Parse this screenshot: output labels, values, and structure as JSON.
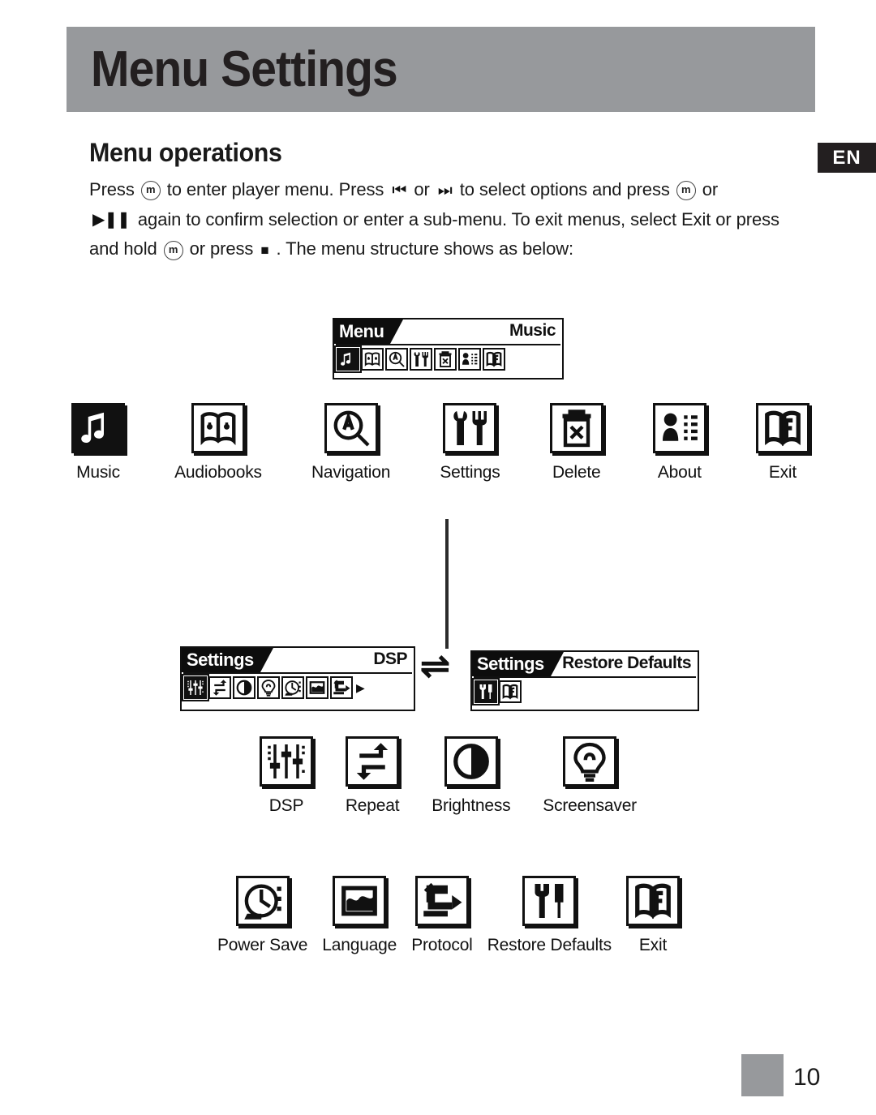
{
  "header": {
    "title": "Menu Settings",
    "band_color": "#97999c"
  },
  "language_badge": {
    "label": "EN",
    "bg": "#231f20"
  },
  "section": {
    "heading": "Menu operations",
    "paragraph_lines": [
      {
        "before": "Press ",
        "icon1": "menu-button-icon",
        "mid1": " to enter player menu. Press ",
        "icon2": "prev-track-icon",
        "mid2": " or ",
        "icon3": "next-track-icon",
        "mid3": " to select options and press ",
        "icon4": "menu-button-icon",
        "after": " or"
      },
      {
        "icon1": "play-pause-icon",
        "text": " again to confirm selection or enter a sub-menu. To exit menus, select Exit or press"
      },
      {
        "before": "and hold ",
        "icon1": "menu-button-icon",
        "mid1": " or press ",
        "icon2": "stop-icon",
        "after": " . The menu structure shows as below:"
      }
    ],
    "glyphs": {
      "menu": "m",
      "prev": "⏮",
      "next": "⏭",
      "play_pause": "▶❙❙",
      "stop": "■"
    }
  },
  "main_menu_screen": {
    "tab_label": "Menu",
    "selected_label": "Music",
    "icons": [
      "music-icon",
      "audiobooks-icon",
      "navigation-icon",
      "settings-icon",
      "delete-icon",
      "about-icon",
      "exit-icon"
    ],
    "selected_index": 0
  },
  "main_menu_items": [
    {
      "label": "Music",
      "icon": "music-icon",
      "selected": true
    },
    {
      "label": "Audiobooks",
      "icon": "audiobooks-icon",
      "selected": false
    },
    {
      "label": "Navigation",
      "icon": "navigation-icon",
      "selected": false
    },
    {
      "label": "Settings",
      "icon": "settings-icon",
      "selected": false
    },
    {
      "label": "Delete",
      "icon": "delete-icon",
      "selected": false
    },
    {
      "label": "About",
      "icon": "about-icon",
      "selected": false
    },
    {
      "label": "Exit",
      "icon": "exit-icon",
      "selected": false
    }
  ],
  "settings_screen_a": {
    "tab_label": "Settings",
    "selected_label": "DSP",
    "icon_count": 7,
    "selected_index": 0,
    "has_more_arrow": true,
    "more_arrow": "▶"
  },
  "settings_screen_b": {
    "tab_label": "Settings",
    "selected_label": "Restore Defaults",
    "icon_count": 2,
    "selected_index": 0,
    "has_more_arrow": false
  },
  "swap_arrow": "⇌",
  "settings_items_row1": [
    {
      "label": "DSP",
      "icon": "dsp-icon"
    },
    {
      "label": "Repeat",
      "icon": "repeat-icon"
    },
    {
      "label": "Brightness",
      "icon": "brightness-icon"
    },
    {
      "label": "Screensaver",
      "icon": "screensaver-icon"
    }
  ],
  "settings_items_row2": [
    {
      "label": "Power Save",
      "icon": "power-save-icon"
    },
    {
      "label": "Language",
      "icon": "language-icon"
    },
    {
      "label": "Protocol",
      "icon": "protocol-icon"
    },
    {
      "label": "Restore Defaults",
      "icon": "restore-defaults-icon"
    },
    {
      "label": "Exit",
      "icon": "exit-icon"
    }
  ],
  "footer": {
    "page_number": "10",
    "marker_color": "#97999c"
  }
}
